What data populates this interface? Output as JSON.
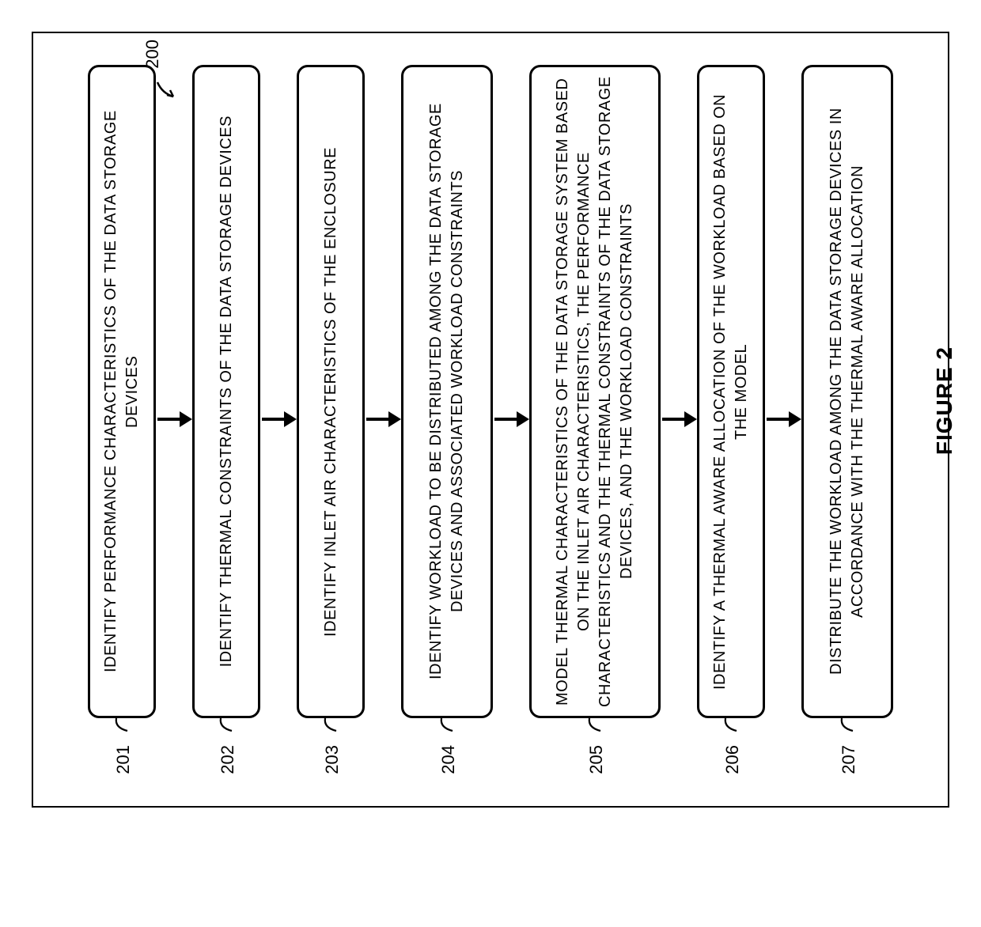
{
  "flow_label": "200",
  "figure_caption": "FIGURE 2",
  "steps": [
    {
      "ref": "201",
      "text": "IDENTIFY PERFORMANCE CHARACTERISTICS OF THE DATA STORAGE DEVICES",
      "size": "normal"
    },
    {
      "ref": "202",
      "text": "IDENTIFY THERMAL CONSTRAINTS OF THE DATA STORAGE DEVICES",
      "size": "normal"
    },
    {
      "ref": "203",
      "text": "IDENTIFY INLET AIR CHARACTERISTICS OF THE ENCLOSURE",
      "size": "normal"
    },
    {
      "ref": "204",
      "text": "IDENTIFY WORKLOAD TO BE DISTRIBUTED AMONG THE DATA STORAGE DEVICES AND ASSOCIATED WORKLOAD CONSTRAINTS",
      "size": "wide"
    },
    {
      "ref": "205",
      "text": "MODEL THERMAL CHARACTERISTICS OF THE DATA STORAGE SYSTEM BASED ON THE INLET AIR CHARACTERISTICS, THE PERFORMANCE CHARACTERISTICS AND THE THERMAL CONSTRAINTS OF THE DATA STORAGE DEVICES, AND THE WORKLOAD CONSTRAINTS",
      "size": "xwide"
    },
    {
      "ref": "206",
      "text": "IDENTIFY A THERMAL AWARE ALLOCATION OF THE WORKLOAD BASED ON THE MODEL",
      "size": "normal"
    },
    {
      "ref": "207",
      "text": "DISTRIBUTE THE WORKLOAD AMONG THE DATA STORAGE DEVICES IN ACCORDANCE WITH THE THERMAL AWARE ALLOCATION",
      "size": "wide"
    }
  ]
}
